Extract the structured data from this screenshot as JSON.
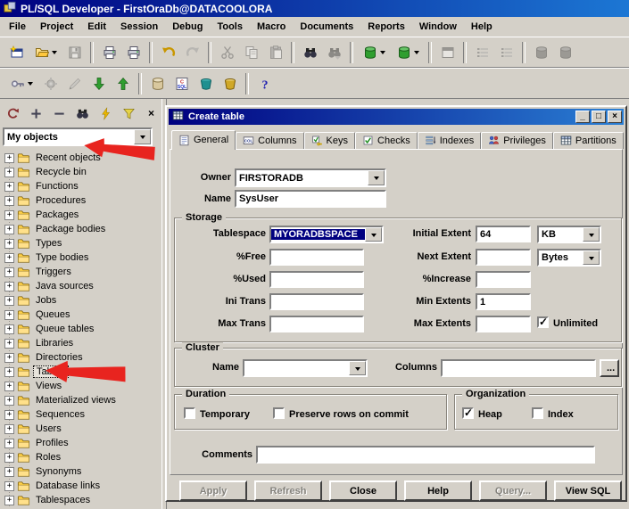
{
  "window": {
    "title": "PL/SQL Developer - FirstOraDb@DATACOOLORA"
  },
  "colors": {
    "face": "#d4d0c8",
    "titlebar_start": "#00007f",
    "titlebar_end": "#1c77d4",
    "selection": "#000080",
    "annotation_arrow": "#e8241f"
  },
  "menu": {
    "items": [
      "File",
      "Project",
      "Edit",
      "Session",
      "Debug",
      "Tools",
      "Macro",
      "Documents",
      "Reports",
      "Window",
      "Help"
    ]
  },
  "toolbar_main": {
    "buttons": [
      {
        "name": "new-item",
        "icon": "new"
      },
      {
        "name": "open-file",
        "icon": "open",
        "dropdown": true
      },
      {
        "name": "save",
        "icon": "save",
        "disabled": true
      },
      {
        "sep": true
      },
      {
        "name": "print",
        "icon": "print"
      },
      {
        "name": "print-setup",
        "icon": "print"
      },
      {
        "sep": true
      },
      {
        "name": "undo",
        "icon": "undo"
      },
      {
        "name": "redo",
        "icon": "redo",
        "disabled": true
      },
      {
        "sep": true
      },
      {
        "name": "cut",
        "icon": "cut",
        "disabled": true
      },
      {
        "name": "copy",
        "icon": "copy",
        "disabled": true
      },
      {
        "name": "paste",
        "icon": "paste",
        "disabled": true
      },
      {
        "sep": true
      },
      {
        "name": "find",
        "icon": "find"
      },
      {
        "name": "find-next",
        "icon": "findnext",
        "disabled": true
      },
      {
        "sep": true
      },
      {
        "name": "commit",
        "icon": "dbgreen",
        "dropdown": true
      },
      {
        "name": "execute",
        "icon": "dbgreen",
        "dropdown": true
      },
      {
        "sep": true
      },
      {
        "name": "window-list",
        "icon": "window",
        "disabled": true
      },
      {
        "sep": true
      },
      {
        "name": "indent",
        "icon": "list",
        "disabled": true
      },
      {
        "name": "outdent",
        "icon": "list",
        "disabled": true
      },
      {
        "sep": true
      },
      {
        "name": "rollback",
        "icon": "dbred",
        "disabled": true
      },
      {
        "name": "break",
        "icon": "dbred",
        "disabled": true
      }
    ]
  },
  "toolbar_secondary": {
    "buttons": [
      {
        "name": "log-on",
        "icon": "key",
        "dropdown": true
      },
      {
        "name": "preferences",
        "icon": "gear",
        "disabled": true
      },
      {
        "name": "edit-object",
        "icon": "pencil",
        "disabled": true
      },
      {
        "name": "import",
        "icon": "arrdown"
      },
      {
        "name": "export",
        "icon": "arrup"
      },
      {
        "sep": true
      },
      {
        "name": "compile",
        "icon": "barrel"
      },
      {
        "name": "sql-window",
        "icon": "csql"
      },
      {
        "name": "test-window",
        "icon": "potteal"
      },
      {
        "name": "command-window",
        "icon": "potgold"
      },
      {
        "sep": true
      },
      {
        "name": "help",
        "icon": "help"
      }
    ]
  },
  "browser": {
    "toolbar": [
      {
        "name": "refresh",
        "icon": "refresh"
      },
      {
        "name": "expand-all",
        "icon": "plusico"
      },
      {
        "name": "collapse-all",
        "icon": "minusico"
      },
      {
        "name": "find-object",
        "icon": "find"
      },
      {
        "name": "quick-actions",
        "icon": "lightning"
      },
      {
        "name": "filter",
        "icon": "funnel"
      }
    ],
    "close_label": "×",
    "selector_value": "My objects",
    "items": [
      "Recent objects",
      "Recycle bin",
      "Functions",
      "Procedures",
      "Packages",
      "Package bodies",
      "Types",
      "Type bodies",
      "Triggers",
      "Java sources",
      "Jobs",
      "Queues",
      "Queue tables",
      "Libraries",
      "Directories",
      "Tables",
      "Views",
      "Materialized views",
      "Sequences",
      "Users",
      "Profiles",
      "Roles",
      "Synonyms",
      "Database links",
      "Tablespaces"
    ],
    "selected_item": "Tables"
  },
  "dialog": {
    "title": "Create table",
    "window_buttons": {
      "minimize": "_",
      "maximize": "□",
      "close": "×"
    },
    "tabs": [
      {
        "label": "General",
        "icon": "form"
      },
      {
        "label": "Columns",
        "icon": "col"
      },
      {
        "label": "Keys",
        "icon": "keycheck"
      },
      {
        "label": "Checks",
        "icon": "check"
      },
      {
        "label": "Indexes",
        "icon": "indexlines"
      },
      {
        "label": "Privileges",
        "icon": "users"
      },
      {
        "label": "Partitions",
        "icon": "grid"
      }
    ],
    "active_tab": "General",
    "general": {
      "owner_label": "Owner",
      "owner_value": "FIRSTORADB",
      "name_label": "Name",
      "name_value": "SysUser",
      "storage": {
        "title": "Storage",
        "tablespace_label": "Tablespace",
        "tablespace_value": "MYORADBSPACE",
        "pct_free_label": "%Free",
        "pct_free_value": "",
        "pct_used_label": "%Used",
        "pct_used_value": "",
        "ini_trans_label": "Ini Trans",
        "ini_trans_value": "",
        "max_trans_label": "Max Trans",
        "max_trans_value": "",
        "initial_extent_label": "Initial Extent",
        "initial_extent_value": "64",
        "initial_extent_unit": "KB",
        "next_extent_label": "Next Extent",
        "next_extent_value": "",
        "next_extent_unit": "Bytes",
        "pct_increase_label": "%Increase",
        "pct_increase_value": "",
        "min_extents_label": "Min Extents",
        "min_extents_value": "1",
        "max_extents_label": "Max Extents",
        "max_extents_value": "",
        "unlimited_label": "Unlimited",
        "unlimited_checked": true
      },
      "cluster": {
        "title": "Cluster",
        "name_label": "Name",
        "name_value": "",
        "columns_label": "Columns",
        "columns_value": "",
        "browse_label": "..."
      },
      "duration": {
        "title": "Duration",
        "temporary_label": "Temporary",
        "temporary_checked": false,
        "preserve_label": "Preserve rows on commit",
        "preserve_checked": false
      },
      "organization": {
        "title": "Organization",
        "heap_label": "Heap",
        "heap_checked": true,
        "index_label": "Index",
        "index_checked": false
      },
      "comments_label": "Comments",
      "comments_value": ""
    },
    "buttons": [
      {
        "label": "Apply",
        "disabled": true
      },
      {
        "label": "Refresh",
        "disabled": true
      },
      {
        "label": "Close",
        "disabled": false
      },
      {
        "label": "Help",
        "disabled": false
      },
      {
        "label": "Query...",
        "disabled": true
      },
      {
        "label": "View SQL",
        "disabled": false
      }
    ]
  }
}
